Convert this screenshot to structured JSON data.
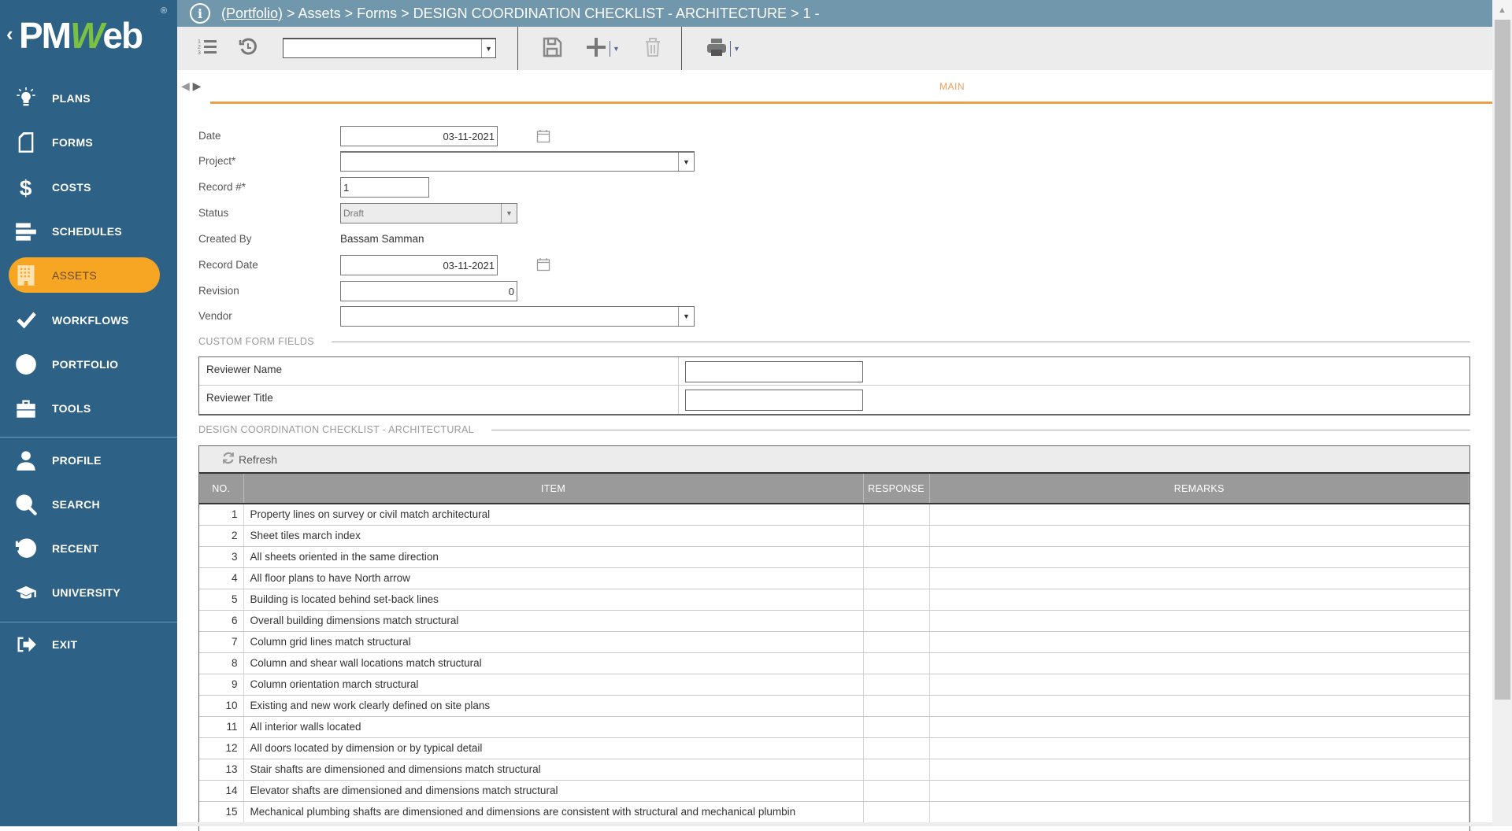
{
  "app": {
    "brand_prefix": "PM",
    "brand_w": "W",
    "brand_suffix": "eb",
    "registered": "®",
    "back_glyph": "‹"
  },
  "sidebar": {
    "items": [
      {
        "label": "PLANS",
        "icon": "lightbulb-icon",
        "active": false
      },
      {
        "label": "FORMS",
        "icon": "document-icon",
        "active": false
      },
      {
        "label": "COSTS",
        "icon": "dollar-icon",
        "active": false
      },
      {
        "label": "SCHEDULES",
        "icon": "gantt-icon",
        "active": false
      },
      {
        "label": "ASSETS",
        "icon": "building-icon",
        "active": true
      },
      {
        "label": "WORKFLOWS",
        "icon": "checkmark-icon",
        "active": false
      },
      {
        "label": "PORTFOLIO",
        "icon": "globe-icon",
        "active": false
      },
      {
        "label": "TOOLS",
        "icon": "toolbox-icon",
        "active": false
      },
      {
        "label": "PROFILE",
        "icon": "user-icon",
        "active": false
      },
      {
        "label": "SEARCH",
        "icon": "search-icon",
        "active": false
      },
      {
        "label": "RECENT",
        "icon": "history-icon",
        "active": false
      },
      {
        "label": "UNIVERSITY",
        "icon": "graduation-cap-icon",
        "active": false
      },
      {
        "label": "EXIT",
        "icon": "exit-icon",
        "active": false
      }
    ],
    "accent": "#f6a623",
    "background": "#2d6185"
  },
  "breadcrumb": {
    "info_glyph": "i",
    "link": "(Portfolio)",
    "rest": " > Assets > Forms > DESIGN COORDINATION CHECKLIST - ARCHITECTURE > 1 -"
  },
  "toolbar": {
    "select_value": "",
    "buttons": [
      "list-icon",
      "history-icon",
      "save-icon",
      "add-icon",
      "delete-icon",
      "print-icon"
    ]
  },
  "tabs": {
    "prev_glyph": "◀",
    "next_glyph": "▶",
    "main_label": "MAIN"
  },
  "form": {
    "date": {
      "label": "Date",
      "value": "03-11-2021"
    },
    "project": {
      "label": "Project*",
      "value": ""
    },
    "record_no": {
      "label": "Record #*",
      "value": "1"
    },
    "status": {
      "label": "Status",
      "value": "Draft"
    },
    "created_by": {
      "label": "Created By",
      "value": "Bassam Samman"
    },
    "record_date": {
      "label": "Record Date",
      "value": "03-11-2021"
    },
    "revision": {
      "label": "Revision",
      "value": "0"
    },
    "vendor": {
      "label": "Vendor",
      "value": ""
    }
  },
  "custom_fields": {
    "title": "CUSTOM FORM FIELDS",
    "rows": [
      {
        "label": "Reviewer Name",
        "value": ""
      },
      {
        "label": "Reviewer Title",
        "value": ""
      }
    ]
  },
  "checklist": {
    "title": "DESIGN COORDINATION CHECKLIST - ARCHITECTURAL",
    "refresh_label": "Refresh",
    "columns": [
      "NO.",
      "ITEM",
      "RESPONSE",
      "REMARKS"
    ],
    "rows": [
      {
        "no": "1",
        "item": "Property lines on survey or civil match architectural",
        "response": "",
        "remarks": ""
      },
      {
        "no": "2",
        "item": "Sheet tiles march index",
        "response": "",
        "remarks": ""
      },
      {
        "no": "3",
        "item": "All sheets oriented in the same direction",
        "response": "",
        "remarks": ""
      },
      {
        "no": "4",
        "item": "All floor plans to have North arrow",
        "response": "",
        "remarks": ""
      },
      {
        "no": "5",
        "item": "Building is located behind set-back lines",
        "response": "",
        "remarks": ""
      },
      {
        "no": "6",
        "item": "Overall building dimensions match structural",
        "response": "",
        "remarks": ""
      },
      {
        "no": "7",
        "item": "Column grid lines match structural",
        "response": "",
        "remarks": ""
      },
      {
        "no": "8",
        "item": "Column and shear wall locations match structural",
        "response": "",
        "remarks": ""
      },
      {
        "no": "9",
        "item": "Column orientation march structural",
        "response": "",
        "remarks": ""
      },
      {
        "no": "10",
        "item": "Existing and new work clearly defined on site plans",
        "response": "",
        "remarks": ""
      },
      {
        "no": "11",
        "item": "All interior walls located",
        "response": "",
        "remarks": ""
      },
      {
        "no": "12",
        "item": "All doors located by dimension or by typical detail",
        "response": "",
        "remarks": ""
      },
      {
        "no": "13",
        "item": "Stair shafts are dimensioned and dimensions match structural",
        "response": "",
        "remarks": ""
      },
      {
        "no": "14",
        "item": "Elevator shafts are dimensioned and dimensions match structural",
        "response": "",
        "remarks": ""
      },
      {
        "no": "15",
        "item": "Mechanical plumbing shafts are dimensioned and dimensions are consistent with structural and mechanical plumbin",
        "response": "",
        "remarks": ""
      }
    ]
  },
  "colors": {
    "topbar": "#7197ad",
    "tab_accent": "#eaa04c",
    "header_gray": "#9a9a9a"
  }
}
